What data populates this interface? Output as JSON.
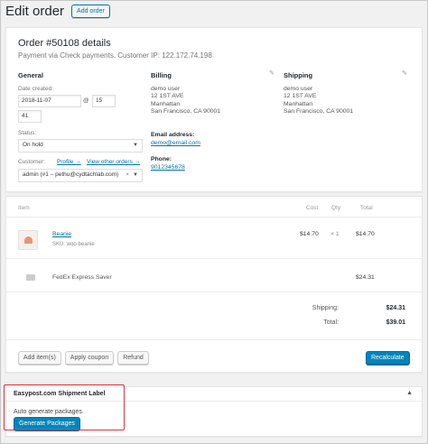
{
  "header": {
    "title": "Edit order",
    "add_order_label": "Add order"
  },
  "order": {
    "title": "Order #50108 details",
    "subtitle": "Payment via Check payments. Customer IP: 122.172.74.198"
  },
  "general": {
    "heading": "General",
    "date_label": "Date created:",
    "date_value": "2018-11-07",
    "at_symbol": "@",
    "hour": "15",
    "minute": "41",
    "status_label": "Status:",
    "status_value": "On hold",
    "customer_label": "Customer:",
    "profile_link": "Profile →",
    "other_orders_link": "View other orders →",
    "customer_value": "admin (#1 – pethu@cydtachlab.com)",
    "clear_symbol": "×"
  },
  "billing": {
    "heading": "Billing",
    "address_lines": [
      "demo user",
      "12 1ST AVE",
      "Manhattan",
      "San Francisco, CA 90001"
    ],
    "email_label": "Email address:",
    "email": "demo@email.com",
    "phone_label": "Phone:",
    "phone": "9012345678"
  },
  "shipping": {
    "heading": "Shipping",
    "address_lines": [
      "demo user",
      "12 1ST AVE",
      "Manhattan",
      "San Francisco, CA 90001"
    ]
  },
  "items": {
    "columns": {
      "item": "Item",
      "cost": "Cost",
      "qty": "Qty",
      "total": "Total"
    },
    "line": {
      "name": "Beanie",
      "sku": "SKU: woo-beanie",
      "cost": "$14.70",
      "qty_times": "× 1",
      "total": "$14.70"
    },
    "shipping_line": {
      "name": "FedEx Express Saver",
      "total": "$24.31"
    },
    "totals": {
      "shipping_label": "Shipping:",
      "shipping_value": "$24.31",
      "total_label": "Total:",
      "total_value": "$39.01"
    },
    "buttons": {
      "add_items": "Add item(s)",
      "apply_coupon": "Apply coupon",
      "refund": "Refund",
      "recalculate": "Recalculate"
    }
  },
  "easypost": {
    "title": "Easypost.com Shipment Label",
    "toggle": "▲",
    "text": "Auto generate packages.",
    "button": "Generate Packages"
  },
  "colors": {
    "accent": "#0073aa",
    "primary_button": "#0085ba",
    "highlight": "#d9363e"
  }
}
